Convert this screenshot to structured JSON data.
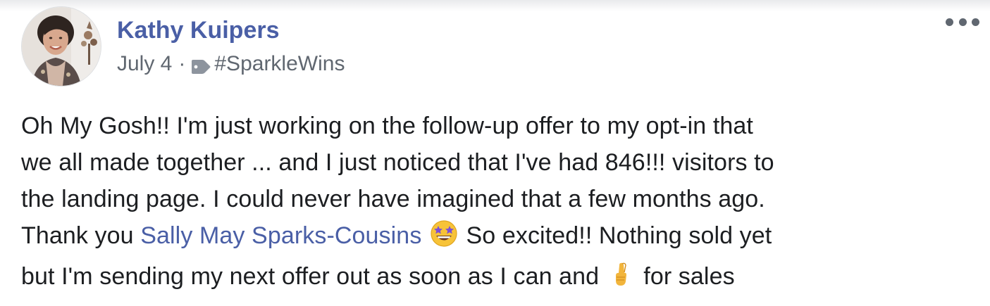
{
  "post": {
    "author": "Kathy Kuipers",
    "date": "July 4",
    "separator": "·",
    "hashtag": "#SparkleWins",
    "more_icon": "more-horizontal-icon",
    "body": {
      "line1": "Oh My Gosh!! I'm just working on the follow-up offer to my opt-in that",
      "line2": "we all made together ... and I just noticed that I've had 846!!! visitors to",
      "line3": "the landing page. I could never have imagined that a few months ago.",
      "line4_start": "Thank you ",
      "mention": "Sally May Sparks-Cousins",
      "line4_end": " So excited!! Nothing sold yet",
      "line5_start": "but I'm sending my next offer out as soon as I can and ",
      "line5_end": " for sales",
      "emoji_1": "star-struck-emoji",
      "emoji_2": "crossed-fingers-emoji"
    }
  },
  "colors": {
    "author": "#4a5fa6",
    "mention": "#4a5fa6",
    "meta_text": "#606770",
    "body_text": "#1c1e21"
  }
}
